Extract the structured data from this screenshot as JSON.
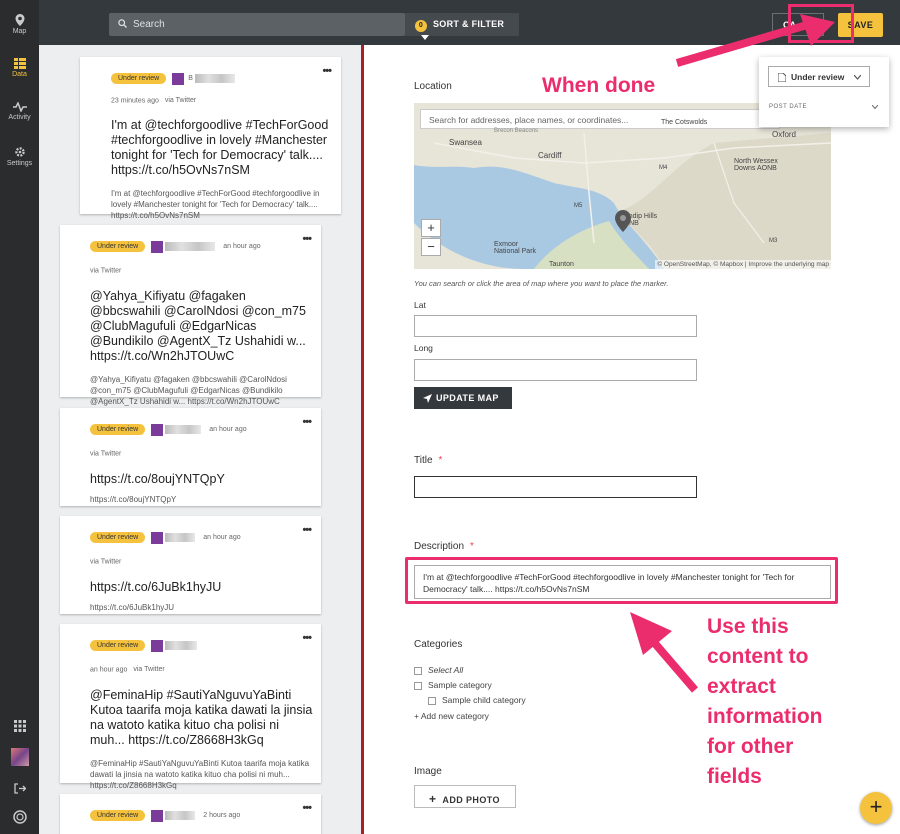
{
  "sidebar": {
    "items": [
      {
        "label": "Map",
        "icon": "map-pin-icon"
      },
      {
        "label": "Data",
        "icon": "data-list-icon",
        "active": true
      },
      {
        "label": "Activity",
        "icon": "activity-icon"
      },
      {
        "label": "Settings",
        "icon": "gear-icon"
      }
    ]
  },
  "topbar": {
    "search_placeholder": "Search",
    "filter_count": "0",
    "sort_filter_label": "SORT & FILTER",
    "cancel_label": "CA...EL",
    "save_label": "SAVE"
  },
  "status_dropdown": {
    "selected": "Under review",
    "post_date_label": "POST DATE"
  },
  "posts": [
    {
      "status": "Under review",
      "author": "B",
      "time": "23 minutes ago",
      "source": "via Twitter",
      "title": "I'm at @techforgoodlive #TechForGood #techforgoodlive in lovely #Manchester tonight for 'Tech for Democracy' talk.... https://t.co/h5OvNs7nSM",
      "body": "I'm at @techforgoodlive #TechForGood #techforgoodlive in lovely #Manchester tonight for 'Tech for Democracy' talk.... https://t.co/h5OvNs7nSM"
    },
    {
      "status": "Under review",
      "author": "",
      "time": "an hour ago",
      "source": "via Twitter",
      "title": "@Yahya_Kifiyatu @fagaken @bbcswahili @CarolNdosi @con_m75 @ClubMagufuli @EdgarNicas @Bundikilo @AgentX_Tz Ushahidi w... https://t.co/Wn2hJTOUwC",
      "body": "@Yahya_Kifiyatu @fagaken @bbcswahili @CarolNdosi @con_m75 @ClubMagufuli @EdgarNicas @Bundikilo @AgentX_Tz Ushahidi w... https://t.co/Wn2hJTOUwC"
    },
    {
      "status": "Under review",
      "author": "",
      "time": "an hour ago",
      "source": "via Twitter",
      "title": "https://t.co/8oujYNTQpY",
      "body": "https://t.co/8oujYNTQpY"
    },
    {
      "status": "Under review",
      "author": "",
      "time": "an hour ago",
      "source": "via Twitter",
      "title": "https://t.co/6JuBk1hyJU",
      "body": "https://t.co/6JuBk1hyJU"
    },
    {
      "status": "Under review",
      "author": "",
      "time": "an hour ago",
      "source": "via Twitter",
      "title": "@FeminaHip #SautiYaNguvuYaBinti Kutoa taarifa moja katika dawati la jinsia na watoto katika kituo cha polisi ni muh... https://t.co/Z8668H3kGq",
      "body": "@FeminaHip #SautiYaNguvuYaBinti Kutoa taarifa moja katika dawati la jinsia na watoto katika kituo cha polisi ni muh... https://t.co/Z8668H3kGq"
    },
    {
      "status": "Under review",
      "author": "",
      "time": "2 hours ago",
      "source": "",
      "title": "",
      "body": ""
    }
  ],
  "form": {
    "location_label": "Location",
    "map_search_placeholder": "Search for addresses, place names, or coordinates...",
    "map_places": [
      "Swansea",
      "Cardiff",
      "Oxford",
      "The Cotswolds",
      "North Wessex Downs AONB",
      "Mendip Hills AONB",
      "Exmoor National Park",
      "Taunton",
      "M5",
      "M4",
      "M3",
      "Brecon Beacons"
    ],
    "map_attribution": "© OpenStreetMap, © Mapbox | Improve the underlying map",
    "map_hint": "You can search or click the area of map where you want to place the marker.",
    "lat_label": "Lat",
    "long_label": "Long",
    "update_map_label": "UPDATE MAP",
    "title_label": "Title",
    "description_label": "Description",
    "description_value": "I'm at @techforgoodlive #TechForGood #techforgoodlive in lovely #Manchester tonight for 'Tech for Democracy' talk.... https://t.co/h5OvNs7nSM",
    "categories_label": "Categories",
    "categories": [
      "Select All",
      "Sample category",
      "Sample child category"
    ],
    "add_category_label": "+ Add new category",
    "image_label": "Image",
    "add_photo_label": "ADD PHOTO"
  },
  "annotations": {
    "when_done": "When done",
    "use_content": [
      "Use this",
      "content to",
      "extract",
      "information",
      "for other",
      "fields"
    ],
    "color": "#ec2d6d"
  },
  "accent": "#f5c23e"
}
